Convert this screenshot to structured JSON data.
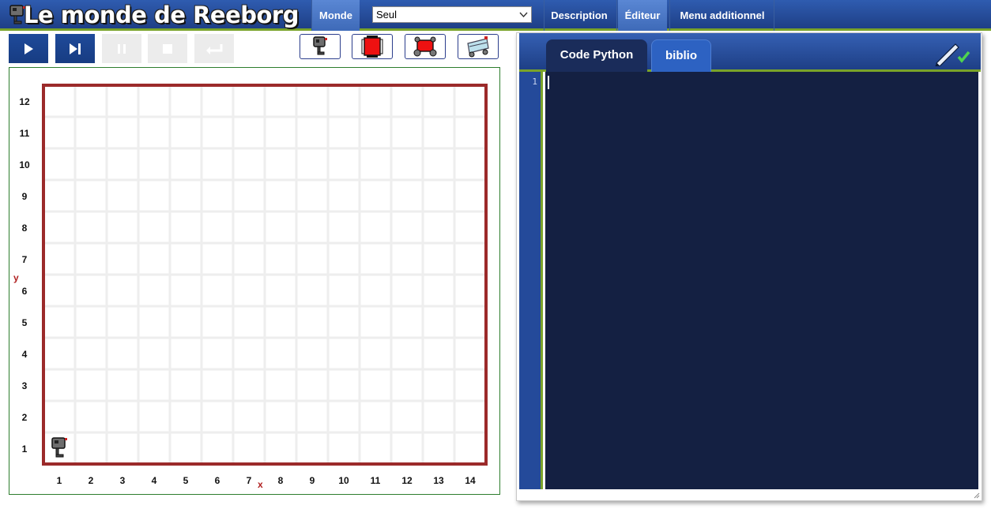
{
  "app": {
    "title": "Le monde de Reeborg"
  },
  "menu": {
    "world_label": "Monde",
    "world_select_value": "Seul",
    "description_label": "Description",
    "editor_label": "Éditeur",
    "extra_menu_label": "Menu additionnel"
  },
  "controls": [
    "run",
    "step",
    "pause",
    "stop",
    "reload"
  ],
  "tools": [
    "robot-icon",
    "world-info-icon",
    "robot-red-icon",
    "robot-tilted-icon"
  ],
  "world": {
    "x_ticks": [
      "1",
      "2",
      "3",
      "4",
      "5",
      "6",
      "7",
      "8",
      "9",
      "10",
      "11",
      "12",
      "13",
      "14"
    ],
    "y_ticks": [
      "1",
      "2",
      "3",
      "4",
      "5",
      "6",
      "7",
      "8",
      "9",
      "10",
      "11",
      "12"
    ],
    "x_axis_label": "x",
    "y_axis_label": "y",
    "robot_position": {
      "x": 1,
      "y": 1
    },
    "wall_color": "#9b2a2a"
  },
  "editor": {
    "tab_code_label": "Code Python",
    "tab_biblio_label": "biblio",
    "line_numbers": [
      "1"
    ],
    "code": ""
  },
  "colors": {
    "header_blue": "#1e3f86",
    "accent_green": "#7aa32a",
    "editor_bg": "#142042"
  }
}
